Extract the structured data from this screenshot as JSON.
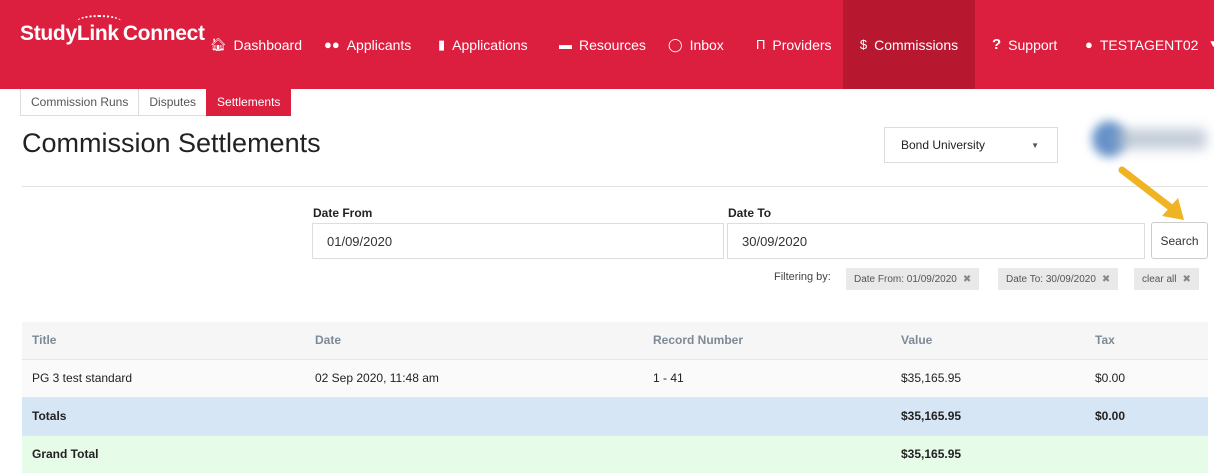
{
  "nav": {
    "brand_study": "StudyLink",
    "brand_connect": "Connect",
    "items": [
      {
        "label": "Dashboard",
        "icon": "home-icon"
      },
      {
        "label": "Applicants",
        "icon": "users-icon"
      },
      {
        "label": "Applications",
        "icon": "file-icon"
      },
      {
        "label": "Resources",
        "icon": "folder-icon"
      },
      {
        "label": "Inbox",
        "icon": "inbox-icon"
      },
      {
        "label": "Providers",
        "icon": "institution-icon"
      },
      {
        "label": "Commissions",
        "icon": "dollar-icon"
      },
      {
        "label": "Support",
        "icon": "question-icon"
      },
      {
        "label": "TESTAGENT02",
        "icon": "user-icon"
      }
    ],
    "active": "Commissions",
    "bg_color": "#dc1f3f"
  },
  "subtabs": [
    "Commission Runs",
    "Disputes",
    "Settlements"
  ],
  "active_subtab": "Settlements",
  "page_title": "Commission Settlements",
  "provider_select": {
    "value": "Bond University"
  },
  "filters": {
    "date_from_label": "Date From",
    "date_from_value": "01/09/2020",
    "date_to_label": "Date To",
    "date_to_value": "30/09/2020",
    "search_label": "Search",
    "filtering_by_label": "Filtering by:",
    "chips": [
      "Date From: 01/09/2020",
      "Date To: 30/09/2020",
      "clear all"
    ]
  },
  "table": {
    "headers": [
      "Title",
      "Date",
      "Record Number",
      "Value",
      "Tax"
    ],
    "rows": [
      {
        "title": "PG 3 test standard",
        "date": "02 Sep 2020, 11:48 am",
        "record": "1 - 41",
        "value": "$35,165.95",
        "tax": "$0.00"
      }
    ],
    "totals": {
      "label": "Totals",
      "value": "$35,165.95",
      "tax": "$0.00"
    },
    "grand_total": {
      "label": "Grand Total",
      "value": "$35,165.95"
    }
  }
}
